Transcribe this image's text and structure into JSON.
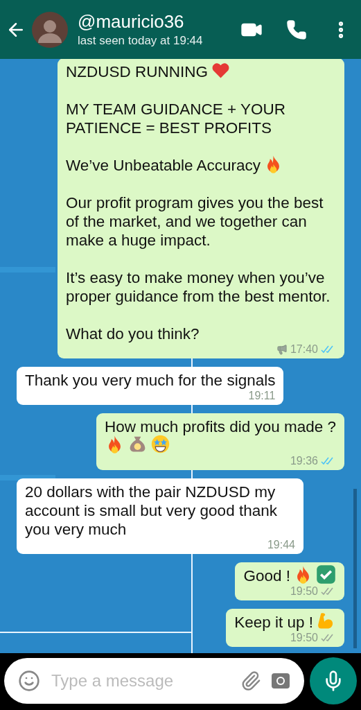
{
  "header": {
    "name": "@mauricio36",
    "status": "last seen today at 19:44"
  },
  "messages": [
    {
      "kind": "outgoing",
      "paragraphs": [
        {
          "text": "NZDUSD RUNNING",
          "emoji": [
            {
              "kind": "heart"
            }
          ]
        },
        {
          "text": "MY TEAM GUIDANCE + YOUR PATIENCE = BEST PROFITS"
        },
        {
          "text": "We’ve Unbeatable Accuracy",
          "emoji": [
            {
              "kind": "fire"
            }
          ]
        },
        {
          "text": "Our profit program gives you the best of the market, and we together can make a huge impact."
        },
        {
          "text": "It’s easy to make money when you’ve proper guidance from the best mentor."
        },
        {
          "text": "What do you think?"
        }
      ],
      "time": "17:40",
      "broadcast": true,
      "read": true
    },
    {
      "kind": "incoming",
      "paragraphs": [
        {
          "text": "Thank you very much for the signals"
        }
      ],
      "time": "19:11"
    },
    {
      "kind": "outgoing",
      "paragraphs": [
        {
          "text": "How much profits did you made ?",
          "emoji_on_new_line": true,
          "emoji": [
            {
              "kind": "fire"
            },
            {
              "kind": "money-bag"
            },
            {
              "kind": "star-eyes"
            }
          ]
        }
      ],
      "time": "19:36",
      "read": true
    },
    {
      "kind": "incoming",
      "paragraphs": [
        {
          "text": "20 dollars with the pair NZDUSD my account is small but very good thank you very much"
        }
      ],
      "time": "19:44"
    },
    {
      "kind": "outgoing",
      "paragraphs": [
        {
          "text": "Good !",
          "emoji": [
            {
              "kind": "fire"
            },
            {
              "kind": "check"
            }
          ]
        }
      ],
      "time": "19:50",
      "read": false
    },
    {
      "kind": "outgoing",
      "paragraphs": [
        {
          "text": "Keep it up !",
          "emoji": [
            {
              "kind": "muscle"
            }
          ]
        }
      ],
      "time": "19:50",
      "read": false
    }
  ],
  "composer": {
    "placeholder": "Type a message"
  }
}
